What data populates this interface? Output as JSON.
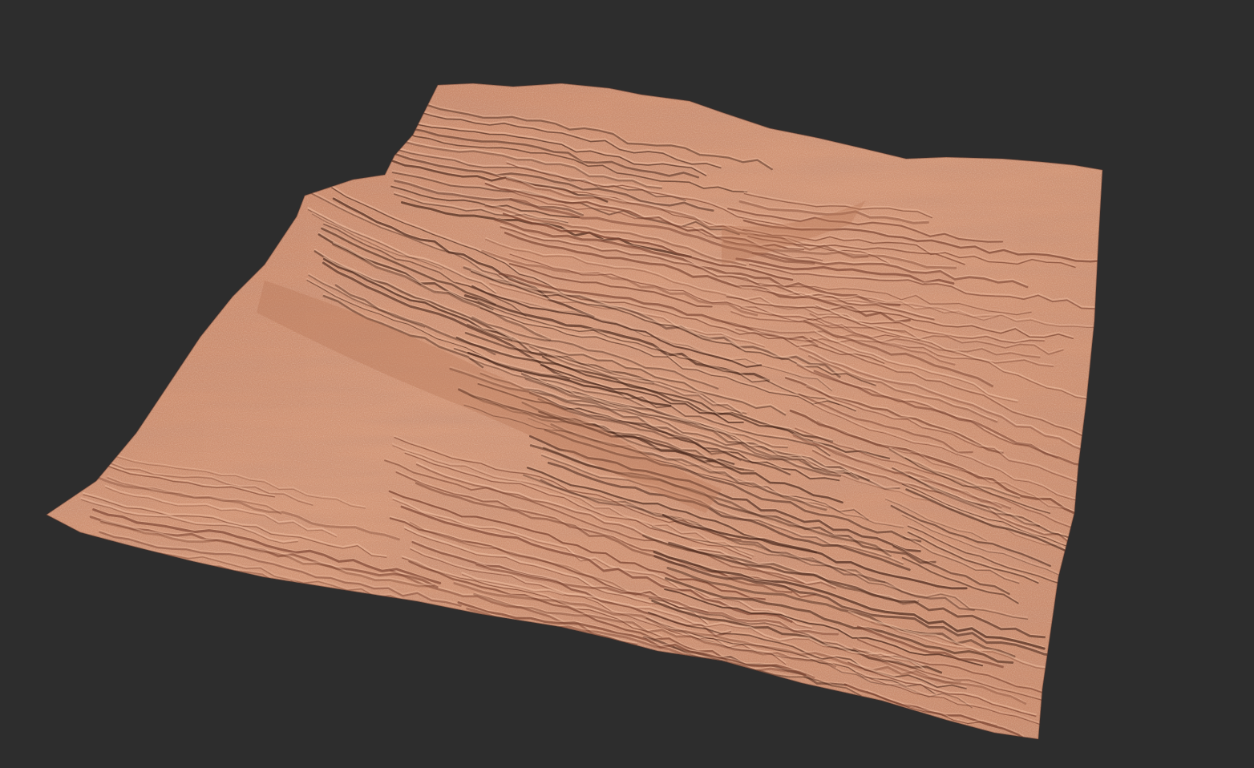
{
  "scene": {
    "background_color": "#2d2d2d",
    "subject": "terrain-heightmap-render",
    "palette": {
      "base": "#c98a6c",
      "light": "#e2a88a",
      "highlight": "#efbfa2",
      "mid": "#b77657",
      "shadow": "#7d4633",
      "deep": "#4a281c"
    }
  }
}
